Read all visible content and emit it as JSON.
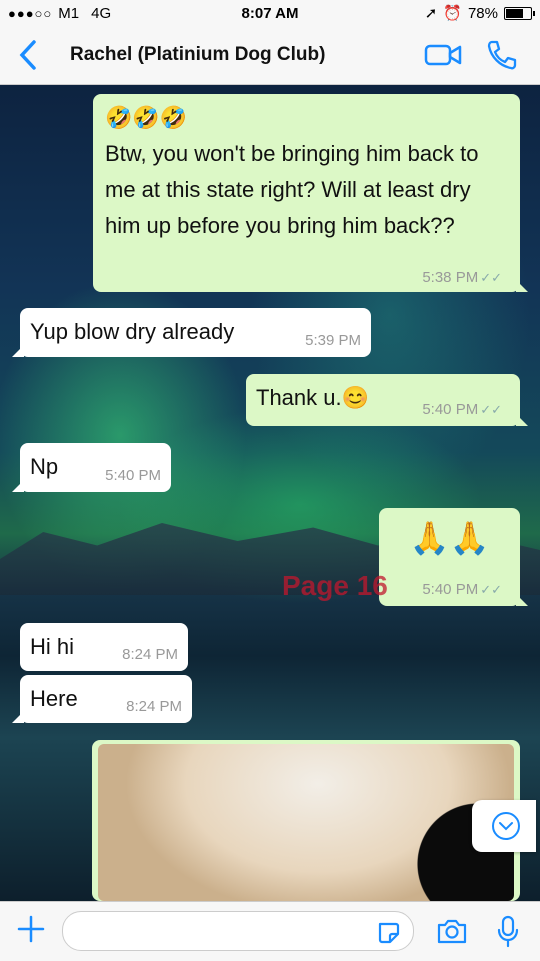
{
  "status_bar": {
    "carrier": "M1",
    "network": "4G",
    "time": "8:07 AM",
    "battery": "78%",
    "battery_level": 0.78
  },
  "header": {
    "back_icon": "chevron-left-icon",
    "title": "Rachel (Platinium Dog Club)",
    "video_icon": "video-call-icon",
    "phone_icon": "phone-icon"
  },
  "messages": [
    {
      "dir": "out",
      "emoji": "🤣🤣🤣",
      "text": "Btw, you won't be bringing him back to me at this state right? Will at least dry him up before you bring him back??",
      "time": "5:38 PM"
    },
    {
      "dir": "in",
      "text": "Yup blow dry already",
      "time": "5:39 PM"
    },
    {
      "dir": "out",
      "text": "Thank u.😊",
      "time": "5:40 PM"
    },
    {
      "dir": "in",
      "text": "Np",
      "time": "5:40 PM"
    },
    {
      "dir": "out",
      "text": "🙏🙏",
      "time": "5:40 PM"
    },
    {
      "dir": "in",
      "text": "Hi hi",
      "time": "8:24 PM"
    },
    {
      "dir": "in",
      "text": "Here",
      "time": "8:24 PM"
    }
  ],
  "watermark": "Page 16",
  "colors": {
    "incoming": "#ffffff",
    "outgoing": "#dcf8c6",
    "accent": "#1a8cff",
    "watermark": "#c0182e"
  },
  "input_bar": {
    "plus_icon": "plus-icon",
    "sticker_icon": "sticker-icon",
    "camera_icon": "camera-icon",
    "mic_icon": "microphone-icon"
  }
}
